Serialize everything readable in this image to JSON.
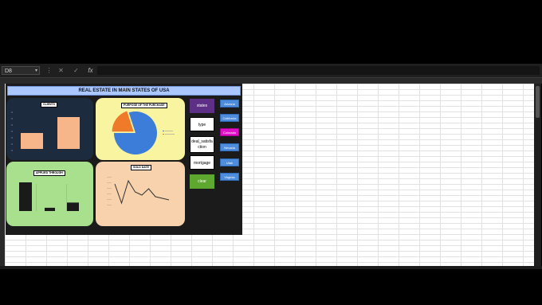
{
  "formula_bar": {
    "cell_ref": "D8",
    "fx_icon": "fx-icon",
    "cancel_icon": "close-icon",
    "confirm_icon": "check-icon",
    "menu_icon": "more-vert-icon"
  },
  "dashboard": {
    "title": "REAL ESTATE IN MAIN STATES OF USA",
    "colors": {
      "title_bg": "#aac7ff",
      "dark_bg": "#1b1b1b",
      "clients_bg": "#1c2b3d",
      "purpose_bg": "#f9f4a0",
      "applied_bg": "#a8e08e",
      "sold_bg": "#f8d2ac"
    },
    "slicers": {
      "states": "states",
      "type": "type",
      "deal_satisfaction": "deal_satisfa ction",
      "mortgage": "mortgage",
      "clear": "clear"
    },
    "state_buttons": [
      "Arizona",
      "California",
      "Colorado",
      "Nevada",
      "Utah",
      "Virginia"
    ]
  },
  "chart_data": [
    {
      "type": "bar",
      "title": "CLIENTS",
      "categories": [
        "",
        ""
      ],
      "values": [
        1,
        2
      ],
      "data_labels": [
        "",
        ""
      ]
    },
    {
      "type": "pie",
      "title": "PURPOSE OF THE PURCHASE",
      "categories": [
        "",
        ""
      ],
      "values": [
        80,
        20
      ],
      "colors": [
        "#3b7dd8",
        "#ef7a2a"
      ]
    },
    {
      "type": "bar",
      "title": "APPLIED THROUGH",
      "categories": [
        "",
        "",
        ""
      ],
      "values": [
        88,
        10,
        26
      ],
      "data_labels": [
        "",
        "",
        ""
      ]
    },
    {
      "type": "line",
      "title": "SOLD DATE",
      "x": [
        "",
        "",
        "",
        "",
        "",
        "",
        "",
        "",
        ""
      ],
      "values": [
        80,
        20,
        90,
        55,
        45,
        65,
        40,
        35,
        30
      ]
    }
  ]
}
